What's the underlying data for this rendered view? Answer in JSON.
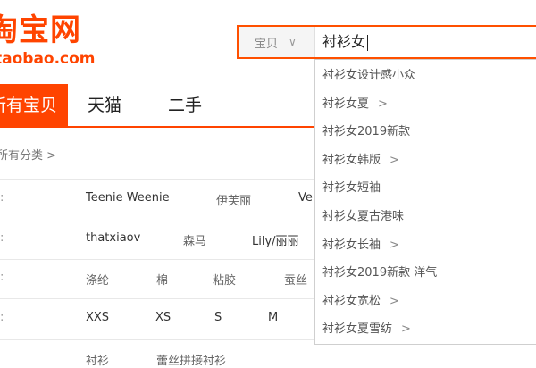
{
  "logo": {
    "title": "淘宝网",
    "domain": "taobao.com"
  },
  "search": {
    "type_label": "宝贝",
    "query": "衬衫女",
    "suggestions": [
      {
        "text": "衬衫女设计感小众",
        "has_more": false
      },
      {
        "text": "衬衫女夏",
        "has_more": true
      },
      {
        "text": "衬衫女2019新款",
        "has_more": false
      },
      {
        "text": "衬衫女韩版",
        "has_more": true
      },
      {
        "text": "衬衫女短袖",
        "has_more": false
      },
      {
        "text": "衬衫女夏古港味",
        "has_more": false
      },
      {
        "text": "衬衫女长袖",
        "has_more": true
      },
      {
        "text": "衬衫女2019新款 洋气",
        "has_more": false
      },
      {
        "text": "衬衫女宽松",
        "has_more": true
      },
      {
        "text": "衬衫女夏雪纺",
        "has_more": true
      }
    ]
  },
  "nav": {
    "active": "所有宝贝",
    "tabs": [
      "天猫",
      "二手"
    ]
  },
  "filters": {
    "breadcrumb": "所有分类",
    "brand_row1": [
      "Teenie Weenie",
      "伊芙丽",
      "Ve"
    ],
    "brand_row2": [
      "thatxiaov",
      "森马",
      "Lily/丽丽"
    ],
    "material_row": [
      "涤纶",
      "棉",
      "粘胶",
      "蚕丝"
    ],
    "size_row": [
      "XXS",
      "XS",
      "S",
      "M"
    ],
    "partial_row": [
      "衬衫",
      "蕾丝拼接衬衫"
    ]
  },
  "icons": {
    "dropdown_chevron": "chevron-down-icon",
    "more_arrow": "chevron-right-icon"
  },
  "colors": {
    "accent": "#ff4400",
    "search_border": "#ff5000"
  }
}
